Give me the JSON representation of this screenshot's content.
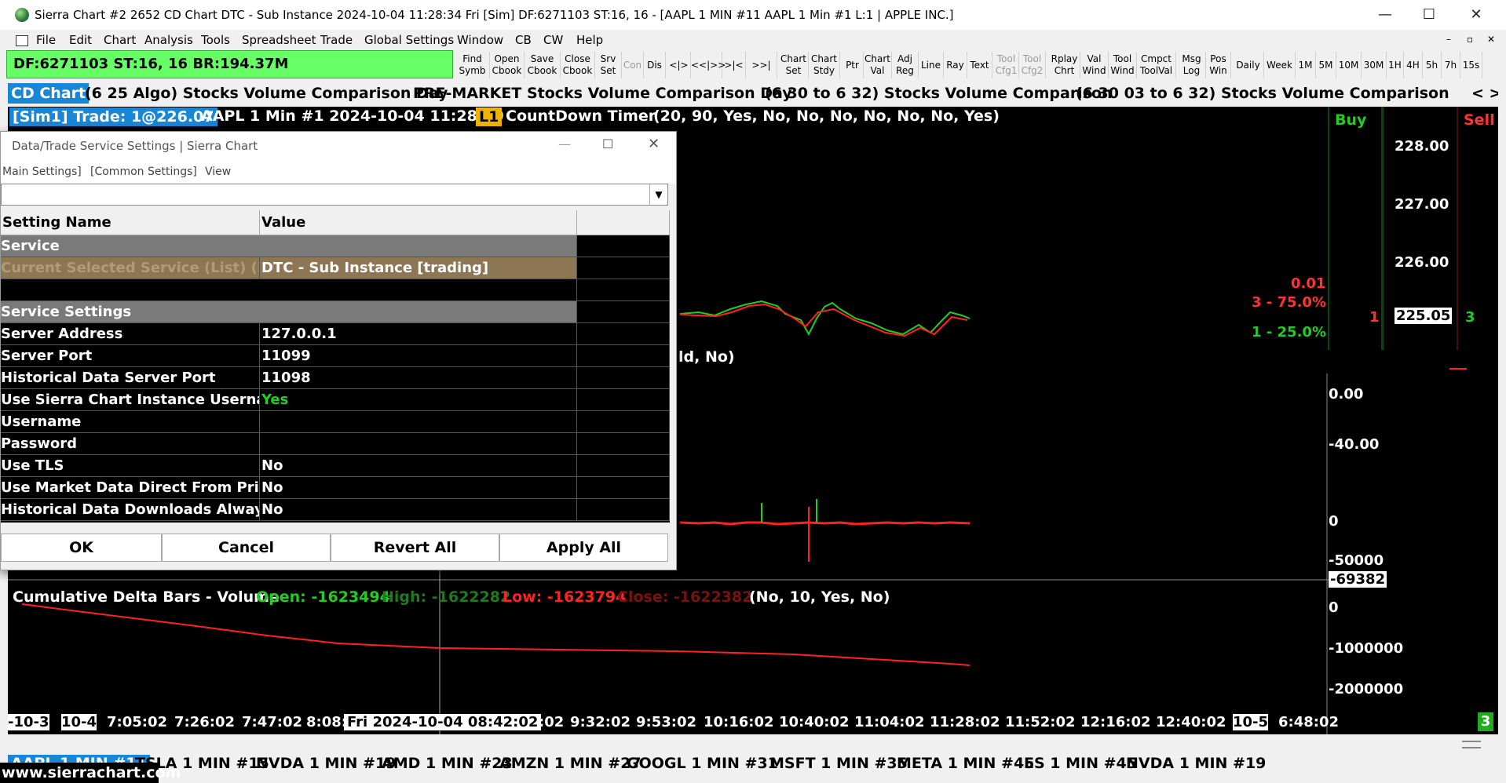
{
  "window": {
    "title": "Sierra Chart #2 2652 CD Chart DTC - Sub Instance 2024-10-04  11:28:34 Fri [Sim] DF:6271103  ST:16, 16 - [AAPL 1 MIN #11 AAPL  1 Min  #1 L:1 | APPLE INC.]",
    "minimize": "—",
    "maximize": "☐",
    "close": "✕"
  },
  "menu": [
    "File",
    "Edit",
    "Chart",
    "Analysis",
    "Tools",
    "Spreadsheet",
    "Trade",
    "Global Settings",
    "Window",
    "CB",
    "CW",
    "Help"
  ],
  "status_bar": "DF:6271103  ST:16, 16  BR:194.37M",
  "toolbar": [
    {
      "label": "Find\nSymb",
      "enabled": true
    },
    {
      "label": "Open\nCbook",
      "enabled": true
    },
    {
      "label": "Save\nCbook",
      "enabled": true
    },
    {
      "label": "Close\nCbook",
      "enabled": true
    },
    {
      "label": "Srv\nSet",
      "enabled": true
    },
    {
      "label": "Con",
      "enabled": false
    },
    {
      "label": "Dis",
      "enabled": true
    },
    {
      "label": "<|>",
      "enabled": true
    },
    {
      "label": "<<|>>",
      "enabled": true
    },
    {
      "label": ">|<",
      "enabled": true
    },
    {
      "label": ">>|<<",
      "enabled": true
    },
    {
      "label": "Chart\nSet",
      "enabled": true
    },
    {
      "label": "Chart\nStdy",
      "enabled": true
    },
    {
      "label": "Ptr",
      "enabled": true
    },
    {
      "label": "Chart\nVal",
      "enabled": true
    },
    {
      "label": "Adj\nReg",
      "enabled": true
    },
    {
      "label": "Line",
      "enabled": true
    },
    {
      "label": "Ray",
      "enabled": true
    },
    {
      "label": "Text",
      "enabled": true
    },
    {
      "label": "Tool\nCfg1",
      "enabled": false
    },
    {
      "label": "Tool\nCfg2",
      "enabled": false
    },
    {
      "label": "Rplay\nChrt",
      "enabled": true
    },
    {
      "label": "Val\nWind",
      "enabled": true
    },
    {
      "label": "Tool\nWind",
      "enabled": true
    },
    {
      "label": "Cmpct\nToolVal",
      "enabled": true
    },
    {
      "label": "Msg\nLog",
      "enabled": true
    },
    {
      "label": "Pos\nWin",
      "enabled": true
    },
    {
      "label": "Daily",
      "enabled": true
    },
    {
      "label": "Week",
      "enabled": true
    },
    {
      "label": "1M",
      "enabled": true
    },
    {
      "label": "5M",
      "enabled": true
    },
    {
      "label": "10M",
      "enabled": true
    },
    {
      "label": "30M",
      "enabled": true
    },
    {
      "label": "1H",
      "enabled": true
    },
    {
      "label": "4H",
      "enabled": true
    },
    {
      "label": "5h",
      "enabled": true
    },
    {
      "label": "7h",
      "enabled": true
    },
    {
      "label": "15s",
      "enabled": true
    }
  ],
  "chart_tabs": [
    "CD Chart",
    "(6 25 Algo) Stocks Volume Comparison Day",
    "PRE-MARKET Stocks Volume Comparison Day",
    "(6 30 to 6 32) Stocks Volume Comparison",
    "(6 30 03 to 6 32) Stocks Volume Comparison"
  ],
  "chart_tab_scroll": "< >",
  "chart_header": {
    "sim_trade": "[Sim1]  Trade: 1@226.07",
    "symbol_info": "AAPL  1 Min  #1 2024-10-04 11:28:29",
    "level": "L1",
    "study": "CountDown Timer",
    "study_params": "(20, 90, Yes, No, No, No, No, No, No, Yes)",
    "overlap_text": "ld, No)"
  },
  "dom": {
    "buy_label": "Buy",
    "sell_label": "Sell",
    "prices": [
      "228.00",
      "227.00",
      "226.00",
      "225.05"
    ],
    "bid_qty": "1",
    "ask_qty": "3",
    "pl": "0.01",
    "pct_red": "3 - 75.0%",
    "pct_green": "1 - 25.0%"
  },
  "delta_axis": [
    "0.00",
    "-40.00",
    "0",
    "-50000",
    "-69382"
  ],
  "cum_delta": {
    "title": "Cumulative Delta Bars - Volume",
    "open": "Open: -1623494",
    "high": "High: -1622282",
    "low": "Low: -1623794",
    "close": "Close: -1622382",
    "params": "(No, 10, Yes, No)",
    "axis": [
      "0",
      "-1000000",
      "-2000000"
    ]
  },
  "time_axis": [
    "-10-3",
    "10-4",
    "7:05:02",
    "7:26:02",
    "7:47:02",
    "8:08:",
    "Fri 2024-10-04  08:42:02",
    ":02",
    "9:32:02",
    "9:53:02",
    "10:16:02",
    "10:40:02",
    "11:04:02",
    "11:28:02",
    "11:52:02",
    "12:16:02",
    "12:40:02",
    "10-5",
    "6:48:02"
  ],
  "corner_badge": "3",
  "dialog": {
    "title": "Data/Trade Service Settings | Sierra Chart",
    "menu": [
      "Main Settings]",
      "[Common Settings]",
      "View"
    ],
    "headers": [
      "Setting Name",
      "Value"
    ],
    "rows": [
      {
        "type": "section",
        "name": "Service",
        "value": ""
      },
      {
        "type": "service",
        "name": "Current Selected Service (List) (Re",
        "value": "DTC - Sub Instance     [trading]"
      },
      {
        "type": "blank",
        "name": "",
        "value": ""
      },
      {
        "type": "section",
        "name": "Service Settings",
        "value": ""
      },
      {
        "type": "row",
        "name": "Server Address",
        "value": "127.0.0.1"
      },
      {
        "type": "row",
        "name": "Server Port",
        "value": "11099"
      },
      {
        "type": "row",
        "name": "Historical Data Server Port",
        "value": "11098"
      },
      {
        "type": "row",
        "name": "Use Sierra Chart Instance Usernam",
        "value": "Yes"
      },
      {
        "type": "row",
        "name": "Username",
        "value": ""
      },
      {
        "type": "row",
        "name": "Password",
        "value": ""
      },
      {
        "type": "row",
        "name": "Use TLS",
        "value": "No"
      },
      {
        "type": "row",
        "name": "Use Market Data Direct From Prima",
        "value": "No"
      },
      {
        "type": "row",
        "name": "Historical Data Downloads Always U",
        "value": "No"
      }
    ],
    "buttons": [
      "OK",
      "Cancel",
      "Revert All",
      "Apply All"
    ]
  },
  "bottom_tabs": [
    "AAPL 1 MIN #11",
    "TSLA 1 MIN #15",
    "NVDA 1 MIN #19",
    "AMD 1 MIN #23",
    "AMZN 1 MIN #27",
    "GOOGL 1 MIN #31",
    "MSFT 1 MIN #35",
    "META 1 MIN #45",
    "ES 1 MIN #45",
    "NVDA 1 MIN #19"
  ],
  "watermark": "www.sierrachart.com",
  "colors": {
    "status_green": "#66ff66",
    "active_tab": "#1a86d6",
    "buy": "#22cc22",
    "sell": "#ff3333",
    "section_gray": "#7a7a7a",
    "service_brown": "#8c7654"
  }
}
